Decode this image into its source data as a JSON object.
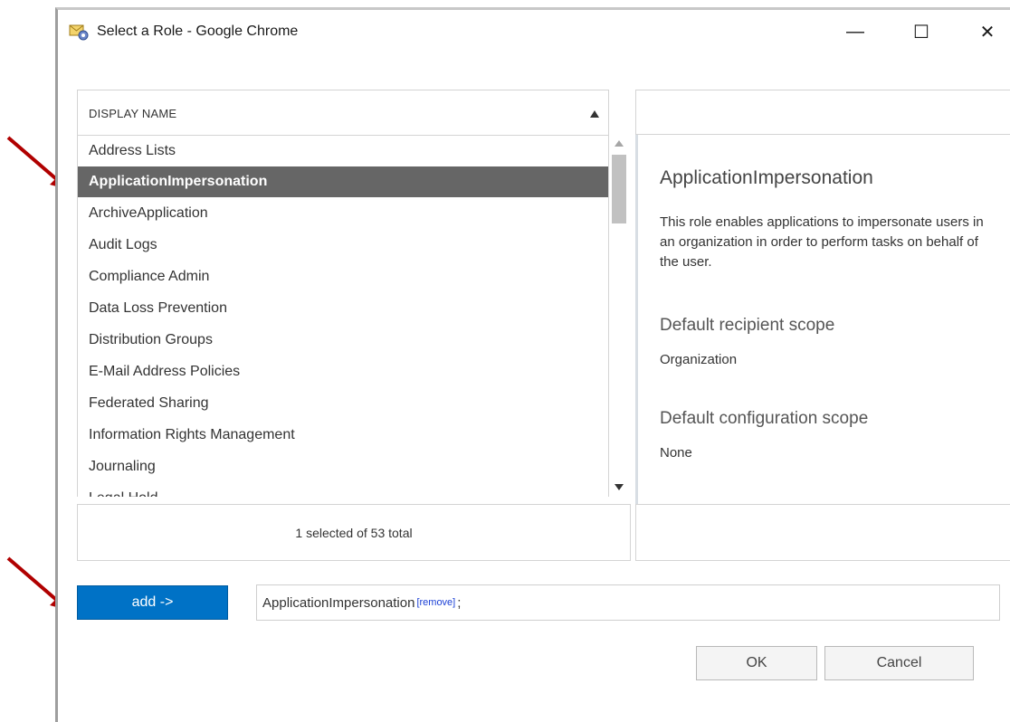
{
  "window": {
    "title": "Select a Role - Google Chrome",
    "controls": {
      "minimize": "—",
      "maximize": "☐",
      "close": "✕"
    }
  },
  "list": {
    "column_header": "DISPLAY NAME",
    "sort_icon": "sort-ascending-icon",
    "items": [
      {
        "label": "Address Lists",
        "selected": false
      },
      {
        "label": "ApplicationImpersonation",
        "selected": true
      },
      {
        "label": "ArchiveApplication",
        "selected": false
      },
      {
        "label": "Audit Logs",
        "selected": false
      },
      {
        "label": "Compliance Admin",
        "selected": false
      },
      {
        "label": "Data Loss Prevention",
        "selected": false
      },
      {
        "label": "Distribution Groups",
        "selected": false
      },
      {
        "label": "E-Mail Address Policies",
        "selected": false
      },
      {
        "label": "Federated Sharing",
        "selected": false
      },
      {
        "label": "Information Rights Management",
        "selected": false
      },
      {
        "label": "Journaling",
        "selected": false
      },
      {
        "label": "Legal Hold",
        "selected": false
      }
    ],
    "status": "1 selected of 53 total"
  },
  "details": {
    "title": "ApplicationImpersonation",
    "description": "This role enables applications to impersonate users in an organization in order to perform tasks on behalf of the user.",
    "recipient_scope_heading": "Default recipient scope",
    "recipient_scope_value": "Organization",
    "config_scope_heading": "Default configuration scope",
    "config_scope_value": "None"
  },
  "add": {
    "button_label": "add ->",
    "selected_value": "ApplicationImpersonation",
    "remove_label": "[remove]",
    "separator": ";"
  },
  "buttons": {
    "ok": "OK",
    "cancel": "Cancel"
  },
  "colors": {
    "accent": "#0072c6",
    "selected_row": "#666666",
    "annotation_arrow": "#b00000",
    "link": "#1a3fd6"
  }
}
